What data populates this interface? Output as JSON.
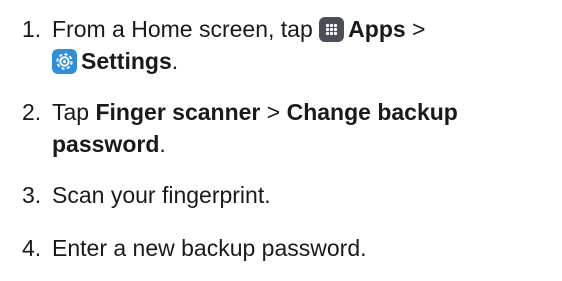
{
  "steps": [
    {
      "number": "1.",
      "line1_prefix": "From a Home screen, tap ",
      "apps_label": "Apps",
      "separator1": " >",
      "settings_label": "Settings",
      "line2_suffix": ".",
      "icons": [
        "apps-grid-icon",
        "settings-gear-icon"
      ]
    },
    {
      "number": "2.",
      "prefix": "Tap ",
      "finger_scanner": "Finger scanner",
      "separator": " > ",
      "change_backup": "Change backup",
      "password": "password",
      "suffix": "."
    },
    {
      "number": "3.",
      "text": "Scan your fingerprint."
    },
    {
      "number": "4.",
      "text": "Enter a new backup password."
    }
  ],
  "colors": {
    "text": "#1a1a1a",
    "apps_icon_bg": "#4a4f57",
    "settings_icon_bg": "#2f8fdc"
  }
}
